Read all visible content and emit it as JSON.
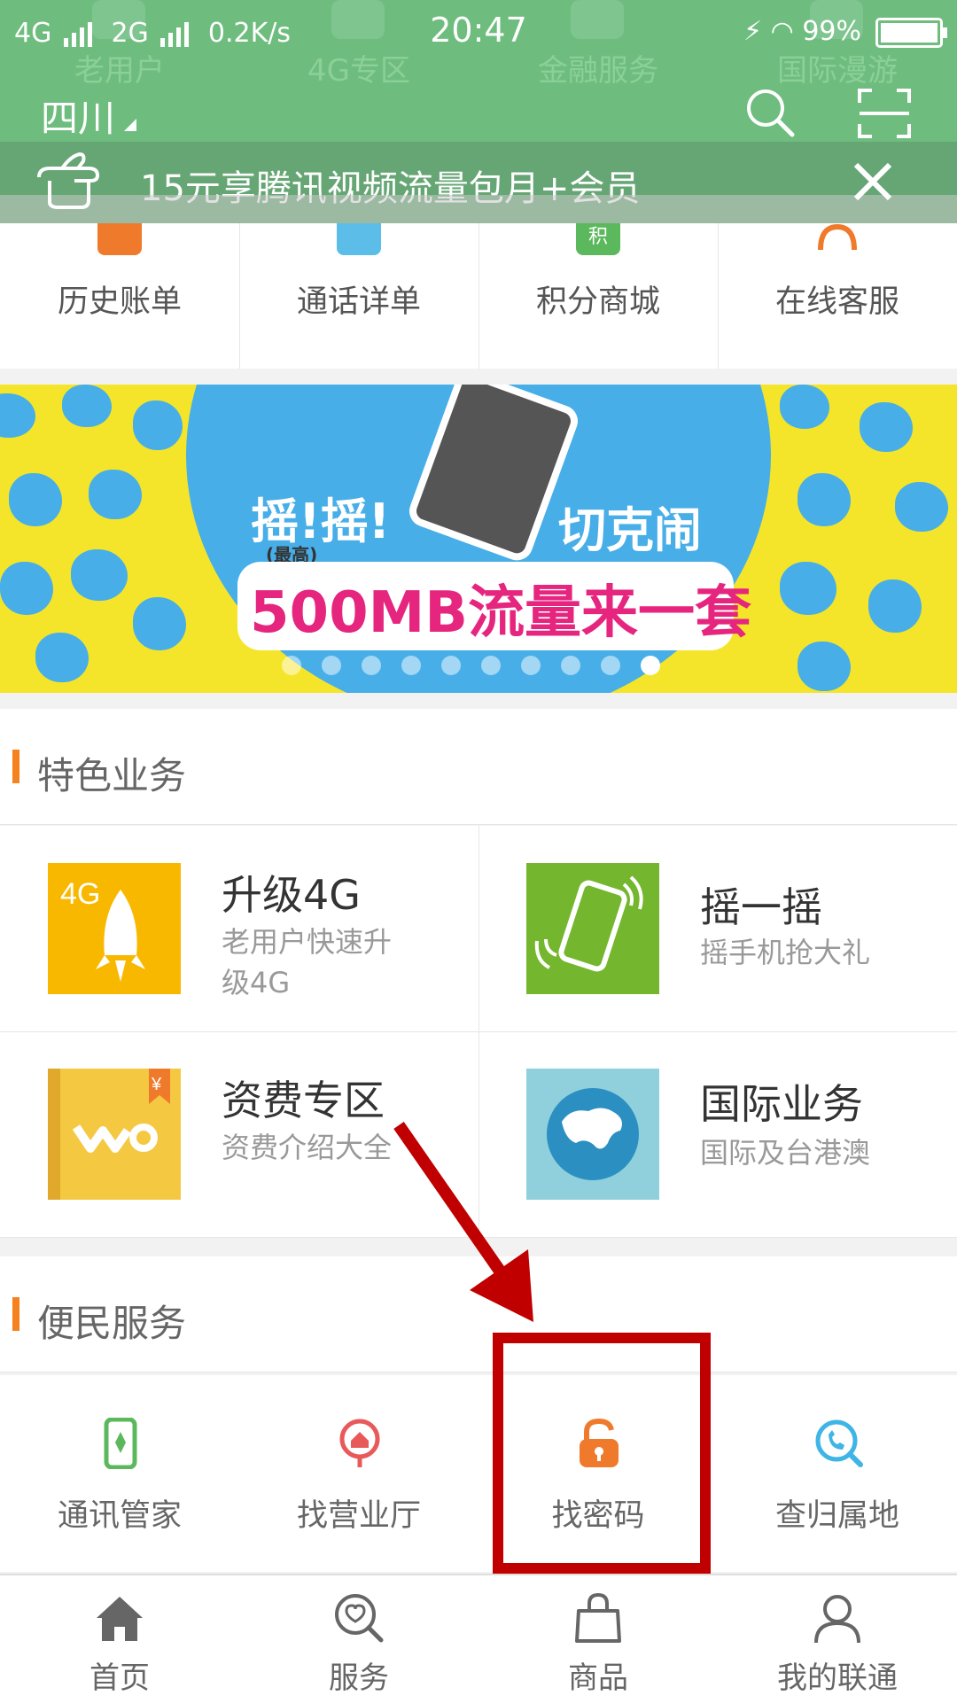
{
  "status_bar": {
    "left": "4G 2G 0.2K/s",
    "net1": "4G",
    "net2": "2G",
    "speed": "0.2K/s",
    "time": "20:47",
    "battery": "99%"
  },
  "header": {
    "ghost_items": [
      "老用户",
      "4G专区",
      "金融服务",
      "国际漫游"
    ],
    "region": "四川",
    "search_icon": "search-icon",
    "scan_icon": "scan-icon",
    "color": "#6ebd7e"
  },
  "notice": {
    "text": "15元享腾讯视频流量包月+会员"
  },
  "quick_links": [
    {
      "label": "历史账单",
      "icon": "bill-icon",
      "color": "#f07a2b"
    },
    {
      "label": "通话详单",
      "icon": "call-detail-icon",
      "color": "#5bbde8"
    },
    {
      "label": "积分商城",
      "icon": "points-bag-icon",
      "color": "#5cb85c",
      "badge": "积"
    },
    {
      "label": "在线客服",
      "icon": "headset-icon",
      "color": "#f07a2b"
    }
  ],
  "banner": {
    "text1": "摇!摇!",
    "text2": "切克闹",
    "text3": "500MB流量来一套",
    "note": "(最高)",
    "slides_total": 10,
    "slide_active": 10
  },
  "featured": {
    "title": "特色业务",
    "items": [
      {
        "title": "升级4G",
        "subtitle": "老用户快速升级4G",
        "icon": "rocket-4g-icon",
        "color": "#f9b800",
        "badge": "4G"
      },
      {
        "title": "摇一摇",
        "subtitle": "摇手机抢大礼",
        "icon": "shake-phone-icon",
        "color": "#74b72e"
      },
      {
        "title": "资费专区",
        "subtitle": "资费介绍大全",
        "icon": "tariff-book-icon",
        "color": "#f5c842",
        "badge": "¥"
      },
      {
        "title": "国际业务",
        "subtitle": "国际及台港澳",
        "icon": "globe-icon",
        "color": "#8fd0dc"
      }
    ]
  },
  "services": {
    "title": "便民服务",
    "items": [
      {
        "label": "通讯管家",
        "icon": "phone-manager-icon",
        "color": "#5cb85c"
      },
      {
        "label": "找营业厅",
        "icon": "store-location-icon",
        "color": "#e8595a"
      },
      {
        "label": "找密码",
        "icon": "unlock-icon",
        "color": "#f07a2b"
      },
      {
        "label": "查归属地",
        "icon": "phone-search-icon",
        "color": "#3fb5e6"
      }
    ]
  },
  "tabbar": [
    {
      "label": "首页",
      "icon": "home-icon"
    },
    {
      "label": "服务",
      "icon": "service-search-icon"
    },
    {
      "label": "商品",
      "icon": "shopping-bag-icon"
    },
    {
      "label": "我的联通",
      "icon": "user-icon"
    }
  ],
  "annotation_color": "#c00000"
}
